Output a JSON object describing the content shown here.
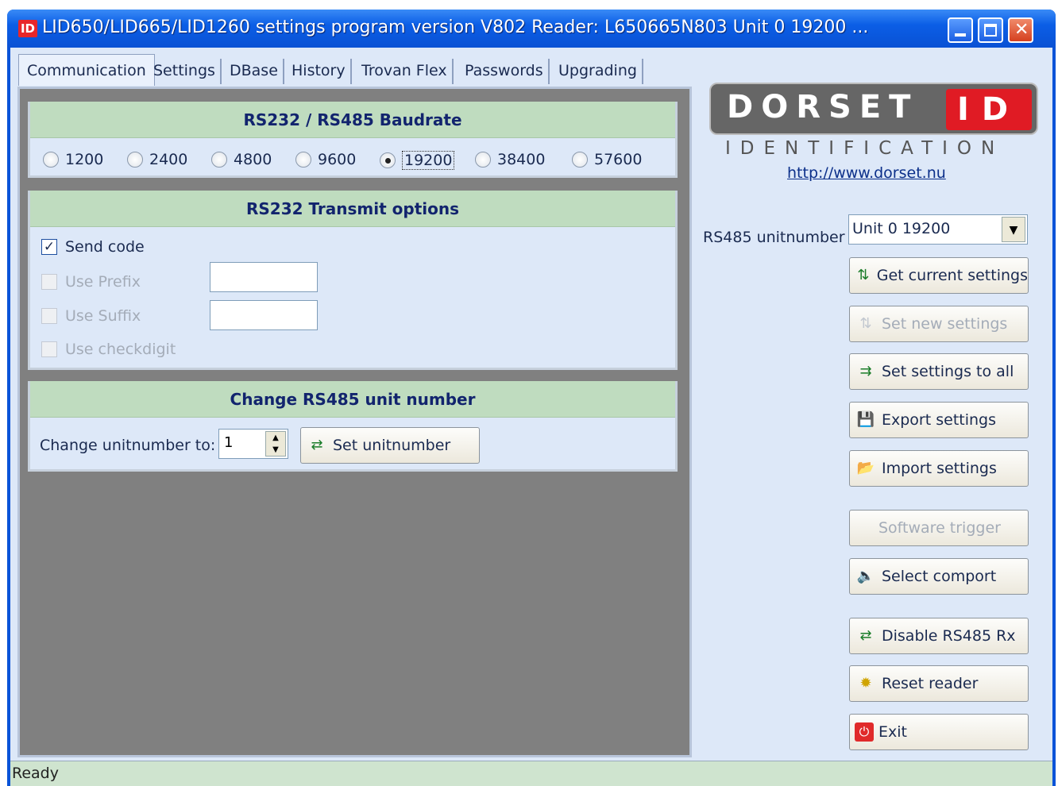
{
  "window": {
    "title": "LID650/LID665/LID1260 settings program version V802  Reader: L650665N803 Unit 0 19200 ...",
    "app_icon": "ID"
  },
  "tabs": [
    {
      "label": "Communication",
      "active": true
    },
    {
      "label": "Settings"
    },
    {
      "label": "DBase"
    },
    {
      "label": "History"
    },
    {
      "label": "Trovan Flex"
    },
    {
      "label": "Passwords"
    },
    {
      "label": "Upgrading"
    }
  ],
  "baudrate": {
    "header": "RS232 / RS485 Baudrate",
    "options": [
      "1200",
      "2400",
      "4800",
      "9600",
      "19200",
      "38400",
      "57600"
    ],
    "selected": "19200"
  },
  "transmit": {
    "header": "RS232 Transmit options",
    "send_code": {
      "label": "Send code",
      "checked": true,
      "mark": "✓"
    },
    "use_prefix": {
      "label": "Use Prefix",
      "value": ""
    },
    "use_suffix": {
      "label": "Use Suffix",
      "value": ""
    },
    "use_checkdigit": {
      "label": "Use checkdigit"
    }
  },
  "unit_change": {
    "header": "Change RS485 unit number",
    "label": "Change unitnumber to:",
    "value": "1",
    "button": "Set unitnumber"
  },
  "logo": {
    "main": "DORSET",
    "id": "ID",
    "sub": "IDENTIFICATION",
    "url": "http://www.dorset.nu"
  },
  "rs485": {
    "label": "RS485 unitnumber",
    "selected": "Unit 0 19200"
  },
  "buttons": {
    "get_current": "Get current settings",
    "set_new": "Set new settings",
    "set_all": "Set settings to all",
    "export": "Export settings",
    "import": "Import settings",
    "software_trigger": "Software trigger",
    "select_comport": "Select comport",
    "disable_rs485": "Disable RS485 Rx",
    "reset_reader": "Reset reader",
    "exit": "Exit"
  },
  "status": "Ready"
}
